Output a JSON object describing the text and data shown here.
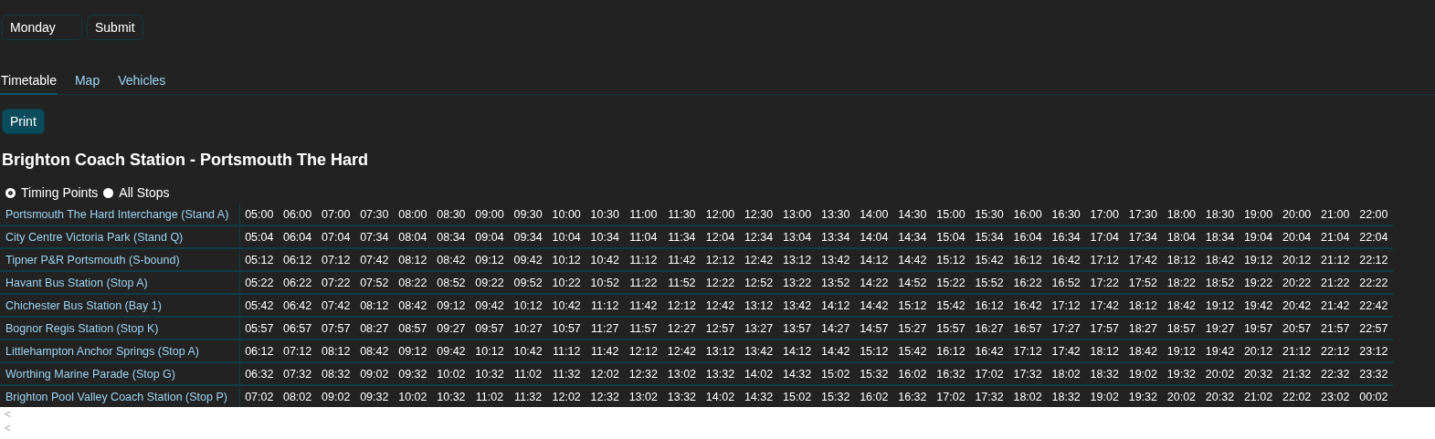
{
  "day_select": {
    "value": "Monday"
  },
  "submit_button": "Submit",
  "tabs": [
    {
      "label": "Timetable",
      "selected": true
    },
    {
      "label": "Map",
      "selected": false
    },
    {
      "label": "Vehicles",
      "selected": false
    }
  ],
  "print_button": "Print",
  "route_title": "Brighton Coach Station - Portsmouth The Hard",
  "stop_filter": [
    {
      "label": "Timing Points",
      "selected": true
    },
    {
      "label": "All Stops",
      "selected": false
    }
  ],
  "timetable": {
    "rows": [
      {
        "stop": "Portsmouth The Hard Interchange (Stand A)",
        "times": [
          "05:00",
          "06:00",
          "07:00",
          "07:30",
          "08:00",
          "08:30",
          "09:00",
          "09:30",
          "10:00",
          "10:30",
          "11:00",
          "11:30",
          "12:00",
          "12:30",
          "13:00",
          "13:30",
          "14:00",
          "14:30",
          "15:00",
          "15:30",
          "16:00",
          "16:30",
          "17:00",
          "17:30",
          "18:00",
          "18:30",
          "19:00",
          "20:00",
          "21:00",
          "22:00"
        ]
      },
      {
        "stop": "City Centre Victoria Park (Stand Q)",
        "times": [
          "05:04",
          "06:04",
          "07:04",
          "07:34",
          "08:04",
          "08:34",
          "09:04",
          "09:34",
          "10:04",
          "10:34",
          "11:04",
          "11:34",
          "12:04",
          "12:34",
          "13:04",
          "13:34",
          "14:04",
          "14:34",
          "15:04",
          "15:34",
          "16:04",
          "16:34",
          "17:04",
          "17:34",
          "18:04",
          "18:34",
          "19:04",
          "20:04",
          "21:04",
          "22:04"
        ]
      },
      {
        "stop": "Tipner P&R Portsmouth (S-bound)",
        "times": [
          "05:12",
          "06:12",
          "07:12",
          "07:42",
          "08:12",
          "08:42",
          "09:12",
          "09:42",
          "10:12",
          "10:42",
          "11:12",
          "11:42",
          "12:12",
          "12:42",
          "13:12",
          "13:42",
          "14:12",
          "14:42",
          "15:12",
          "15:42",
          "16:12",
          "16:42",
          "17:12",
          "17:42",
          "18:12",
          "18:42",
          "19:12",
          "20:12",
          "21:12",
          "22:12"
        ]
      },
      {
        "stop": "Havant Bus Station (Stop A)",
        "times": [
          "05:22",
          "06:22",
          "07:22",
          "07:52",
          "08:22",
          "08:52",
          "09:22",
          "09:52",
          "10:22",
          "10:52",
          "11:22",
          "11:52",
          "12:22",
          "12:52",
          "13:22",
          "13:52",
          "14:22",
          "14:52",
          "15:22",
          "15:52",
          "16:22",
          "16:52",
          "17:22",
          "17:52",
          "18:22",
          "18:52",
          "19:22",
          "20:22",
          "21:22",
          "22:22"
        ]
      },
      {
        "stop": "Chichester Bus Station (Bay 1)",
        "times": [
          "05:42",
          "06:42",
          "07:42",
          "08:12",
          "08:42",
          "09:12",
          "09:42",
          "10:12",
          "10:42",
          "11:12",
          "11:42",
          "12:12",
          "12:42",
          "13:12",
          "13:42",
          "14:12",
          "14:42",
          "15:12",
          "15:42",
          "16:12",
          "16:42",
          "17:12",
          "17:42",
          "18:12",
          "18:42",
          "19:12",
          "19:42",
          "20:42",
          "21:42",
          "22:42"
        ]
      },
      {
        "stop": "Bognor Regis Station (Stop K)",
        "times": [
          "05:57",
          "06:57",
          "07:57",
          "08:27",
          "08:57",
          "09:27",
          "09:57",
          "10:27",
          "10:57",
          "11:27",
          "11:57",
          "12:27",
          "12:57",
          "13:27",
          "13:57",
          "14:27",
          "14:57",
          "15:27",
          "15:57",
          "16:27",
          "16:57",
          "17:27",
          "17:57",
          "18:27",
          "18:57",
          "19:27",
          "19:57",
          "20:57",
          "21:57",
          "22:57"
        ]
      },
      {
        "stop": "Littlehampton Anchor Springs (Stop A)",
        "times": [
          "06:12",
          "07:12",
          "08:12",
          "08:42",
          "09:12",
          "09:42",
          "10:12",
          "10:42",
          "11:12",
          "11:42",
          "12:12",
          "12:42",
          "13:12",
          "13:42",
          "14:12",
          "14:42",
          "15:12",
          "15:42",
          "16:12",
          "16:42",
          "17:12",
          "17:42",
          "18:12",
          "18:42",
          "19:12",
          "19:42",
          "20:12",
          "21:12",
          "22:12",
          "23:12"
        ]
      },
      {
        "stop": "Worthing Marine Parade (Stop G)",
        "times": [
          "06:32",
          "07:32",
          "08:32",
          "09:02",
          "09:32",
          "10:02",
          "10:32",
          "11:02",
          "11:32",
          "12:02",
          "12:32",
          "13:02",
          "13:32",
          "14:02",
          "14:32",
          "15:02",
          "15:32",
          "16:02",
          "16:32",
          "17:02",
          "17:32",
          "18:02",
          "18:32",
          "19:02",
          "19:32",
          "20:02",
          "20:32",
          "21:32",
          "22:32",
          "23:32"
        ]
      },
      {
        "stop": "Brighton Pool Valley Coach Station (Stop P)",
        "times": [
          "07:02",
          "08:02",
          "09:02",
          "09:32",
          "10:02",
          "10:32",
          "11:02",
          "11:32",
          "12:02",
          "12:32",
          "13:02",
          "13:32",
          "14:02",
          "14:32",
          "15:02",
          "15:32",
          "16:02",
          "16:32",
          "17:02",
          "17:32",
          "18:02",
          "18:32",
          "19:02",
          "19:32",
          "20:02",
          "20:32",
          "21:02",
          "22:02",
          "23:02",
          "00:02"
        ]
      }
    ]
  },
  "scroll_arrows": [
    "<",
    "<"
  ]
}
